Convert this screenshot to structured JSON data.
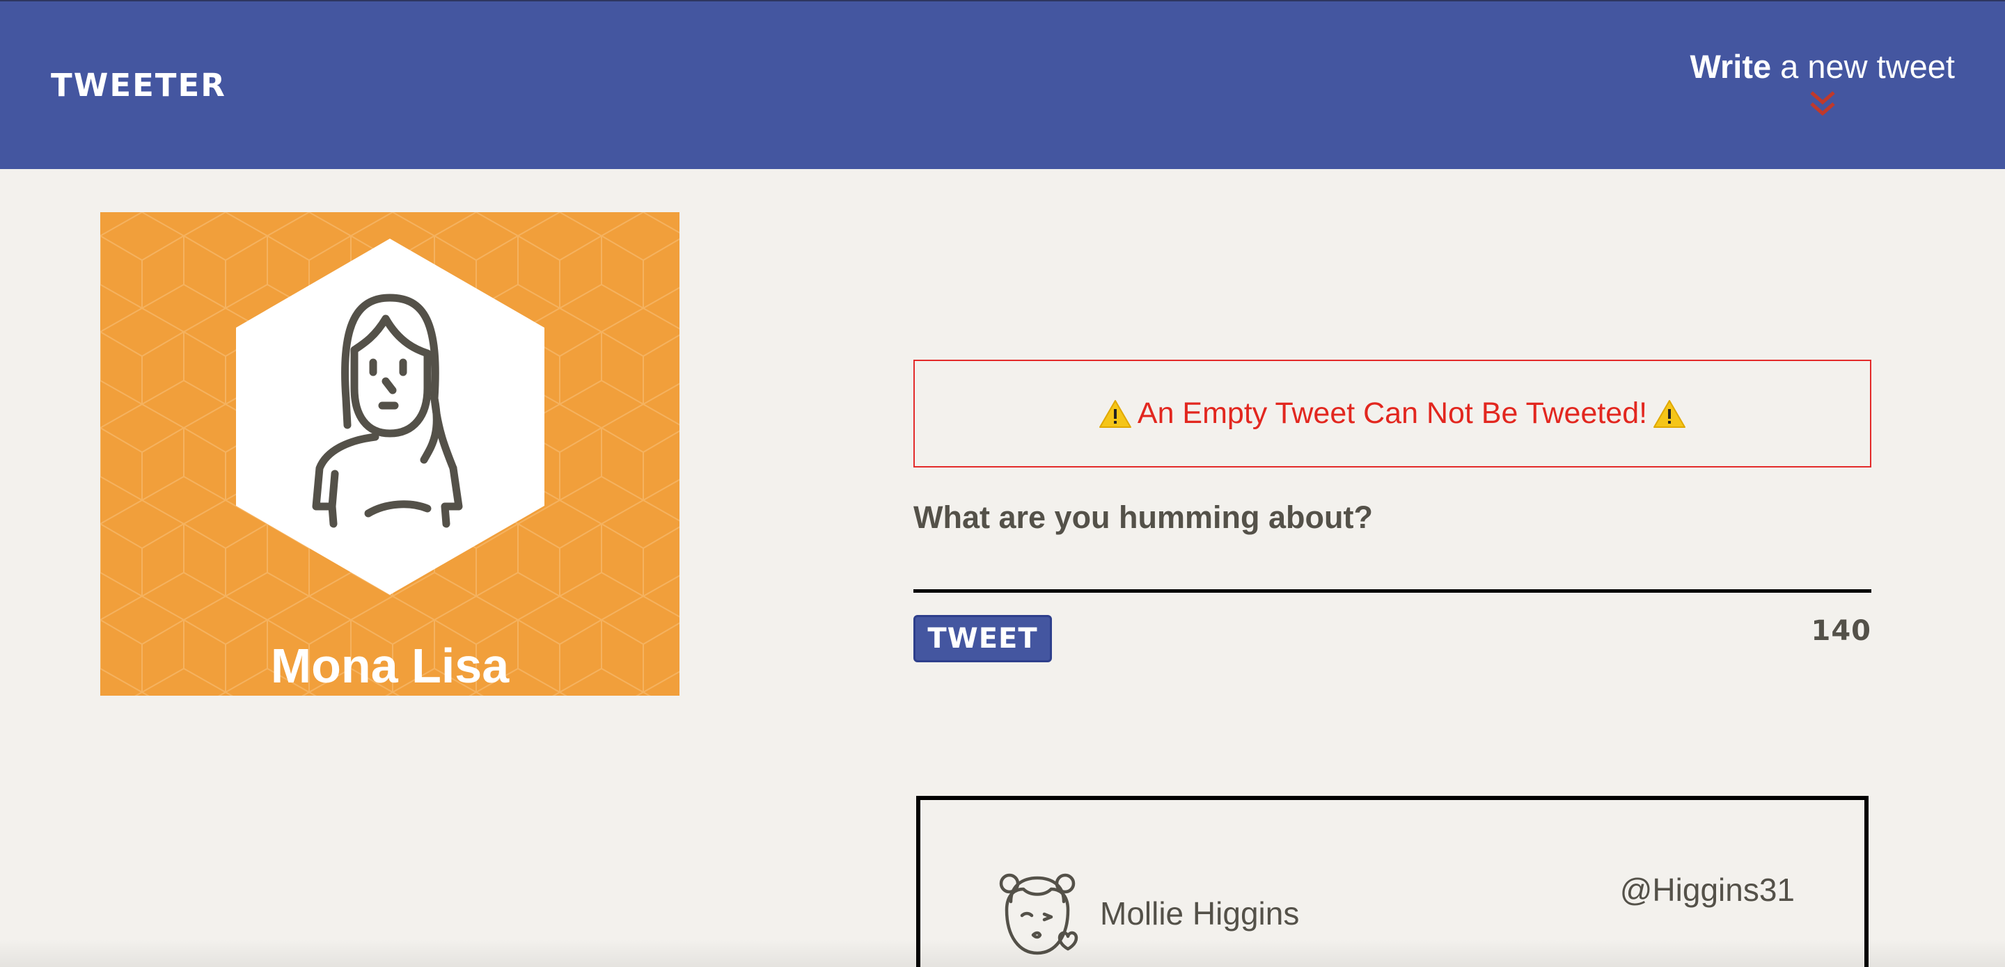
{
  "nav": {
    "brand": "TWEETER",
    "compose_bold": "Write",
    "compose_rest": " a new tweet",
    "compose_icon": "double-chevron-down-icon",
    "color": "#4456a0",
    "chevron_color": "#c0392b"
  },
  "profile": {
    "name": "Mona Lisa",
    "avatar_icon": "woman-avatar-icon",
    "background_color": "#f19f3b"
  },
  "composer": {
    "error_message": "An Empty Tweet Can Not Be Tweeted!",
    "error_icon": "warning-icon",
    "error_color": "#e2271f",
    "label": "What are you humming about?",
    "textarea_value": "",
    "tweet_button": "TWEET",
    "char_count": "140"
  },
  "tweets": [
    {
      "author": "Mollie Higgins",
      "handle": "@Higgins31",
      "avatar_icon": "girl-kiss-avatar-icon"
    }
  ]
}
